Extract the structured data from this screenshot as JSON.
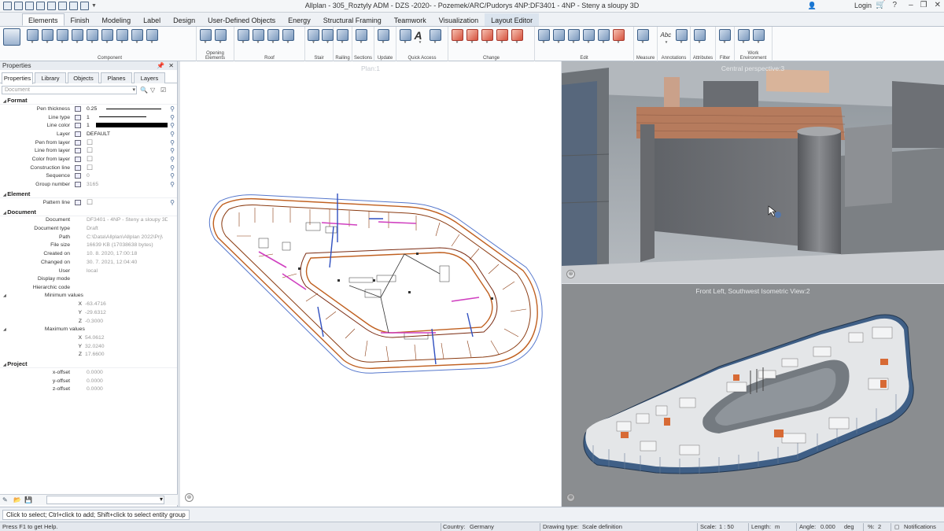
{
  "window": {
    "title": "Allplan - 305_Roztyly ADM - DZS -2020- - Pozemek/ARC/Pudorys 4NP:DF3401 - 4NP - Steny a sloupy 3D",
    "login": "Login",
    "controls": [
      "–",
      "❐",
      "✕"
    ]
  },
  "tabs": [
    "Elements",
    "Finish",
    "Modeling",
    "Label",
    "Design",
    "User-Defined Objects",
    "Energy",
    "Structural Framing",
    "Teamwork",
    "Visualization",
    "Layout Editor"
  ],
  "active_tab": "Elements",
  "ribbon_groups": [
    "Component",
    "Opening Elements",
    "Roof",
    "Stair",
    "Railing",
    "Sections",
    "Update",
    "Quick Access",
    "Change",
    "Edit",
    "Measure",
    "Annotations",
    "Attributes",
    "Filter",
    "Work Environment"
  ],
  "quick_access_text": "A",
  "annotation_text": "Abc",
  "properties": {
    "title": "Properties",
    "tabs": [
      "Properties",
      "Library",
      "Objects",
      "Planes",
      "Layers"
    ],
    "selector_placeholder": "Document",
    "sections": {
      "format": "Format",
      "element": "Element",
      "document": "Document",
      "project": "Project"
    },
    "format_rows": [
      {
        "label": "Pen thickness",
        "value": "0.25"
      },
      {
        "label": "Line type",
        "value": "1"
      },
      {
        "label": "Line color",
        "value": "1"
      },
      {
        "label": "Layer",
        "value": "DEFAULT"
      },
      {
        "label": "Pen from layer",
        "value": ""
      },
      {
        "label": "Line from layer",
        "value": ""
      },
      {
        "label": "Color from layer",
        "value": ""
      },
      {
        "label": "Construction line",
        "value": ""
      },
      {
        "label": "Sequence",
        "value": "0"
      },
      {
        "label": "Group number",
        "value": "3165"
      }
    ],
    "element_rows": [
      {
        "label": "Pattern line",
        "value": ""
      }
    ],
    "document_rows": [
      {
        "label": "Document",
        "value": "DF3401 - 4NP - Steny a sloupy 3D"
      },
      {
        "label": "Document type",
        "value": "Draft"
      },
      {
        "label": "Path",
        "value": "C:\\Data\\Allplan\\Allplan 2022\\Prj\\"
      },
      {
        "label": "File size",
        "value": "16639 KB (17038638 bytes)"
      },
      {
        "label": "Created on",
        "value": "10. 8. 2020, 17:00:18"
      },
      {
        "label": "Changed on",
        "value": "30. 7. 2021, 12:04:40"
      },
      {
        "label": "User",
        "value": "local"
      },
      {
        "label": "Display mode",
        "value": ""
      },
      {
        "label": "Hierarchic code",
        "value": ""
      }
    ],
    "minimum_values": {
      "label": "Minimum values",
      "x": "-63.4716",
      "y": "-29.6312",
      "z": "-0.3000"
    },
    "maximum_values": {
      "label": "Maximum values",
      "x": "54.0612",
      "y": "32.0240",
      "z": "17.6600"
    },
    "axis_labels": {
      "x": "X",
      "y": "Y",
      "z": "Z"
    },
    "project_rows": [
      {
        "label": "x-offset",
        "value": "0.0000"
      },
      {
        "label": "y-offset",
        "value": "0.0000"
      },
      {
        "label": "z-offset",
        "value": "0.0000"
      }
    ]
  },
  "viewports": {
    "plan": "Plan:1",
    "perspective": "Central perspective:3",
    "isometric": "Front Left, Southwest Isometric View:2"
  },
  "prompt": "Click to select; Ctrl+click to add; Shift+click to select entity group",
  "statusbar": {
    "help": "Press F1 to get Help.",
    "country_label": "Country:",
    "country": "Germany",
    "drawing_type_label": "Drawing type:",
    "drawing_type": "Scale definition",
    "scale_label": "Scale:",
    "scale": "1 : 50",
    "length_label": "Length:",
    "length_unit": "m",
    "angle_label": "Angle:",
    "angle": "0.000",
    "angle_unit": "deg",
    "percent_label": "%:",
    "percent": "2",
    "notifications": "Notifications"
  },
  "colors": {
    "accent": "#3c5f88",
    "ribbon_bg": "#fafbfc",
    "viewport_3d": "#9ea5ab"
  }
}
